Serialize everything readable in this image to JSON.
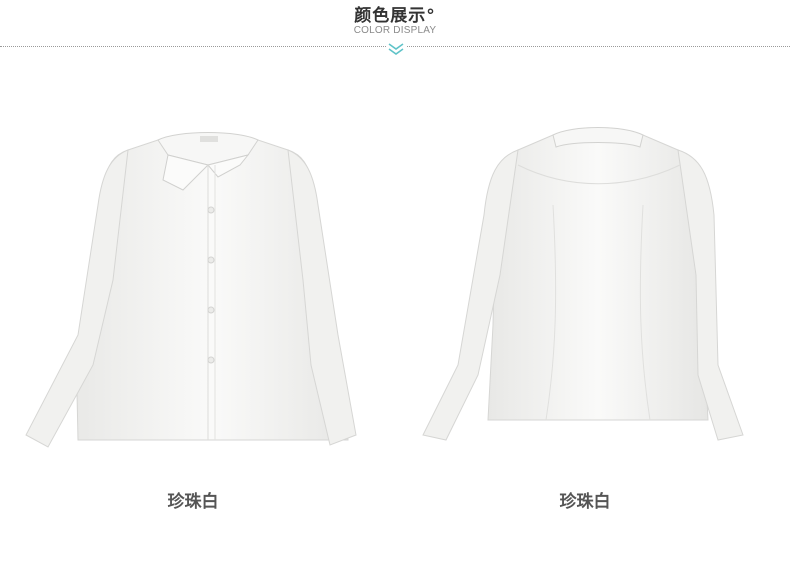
{
  "header": {
    "title": "颜色展示°",
    "subtitle": "COLOR DISPLAY"
  },
  "products": [
    {
      "view": "front",
      "caption": "珍珠白"
    },
    {
      "view": "back",
      "caption": "珍珠白"
    }
  ],
  "colors": {
    "accent": "#5fc3c8",
    "caption": "#555555"
  },
  "icons": [
    "double-chevron-down-icon"
  ]
}
